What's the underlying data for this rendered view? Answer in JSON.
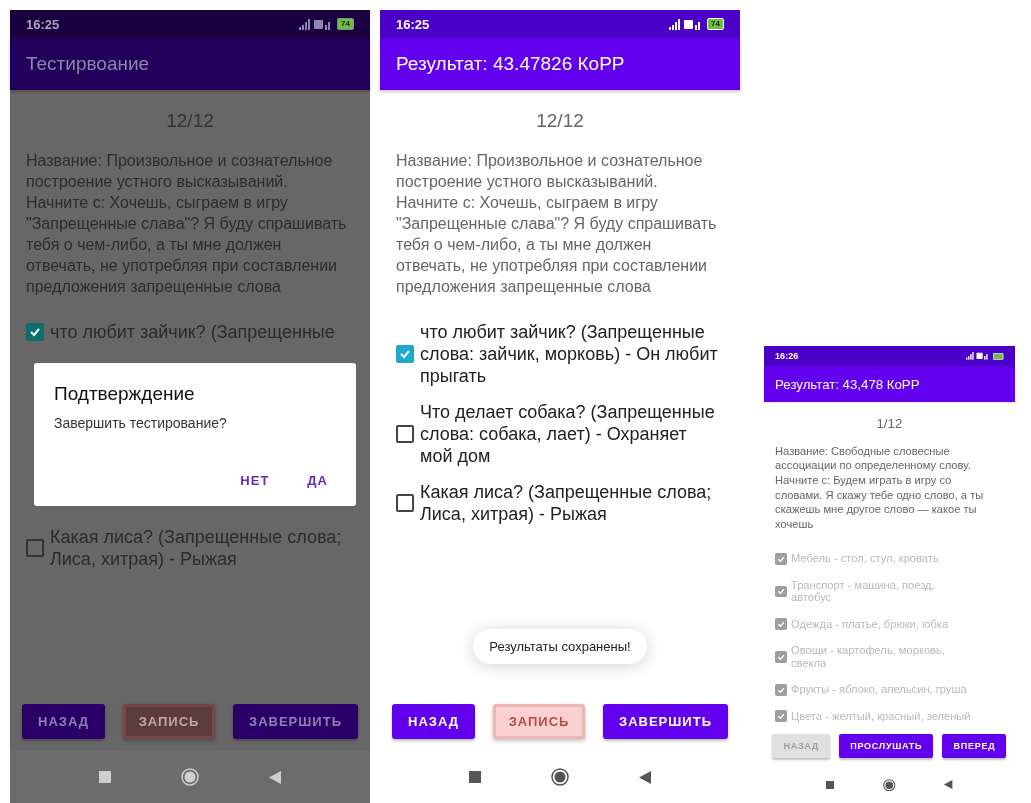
{
  "screens": [
    {
      "dimmed": true,
      "status_bar": {
        "time": "16:25",
        "battery": "74"
      },
      "app_bar": {
        "title": "Тестирвоание"
      },
      "counter": "12/12",
      "description": "Название: Произвольное и сознательное построение устного высказываний. Начните с: Хочешь, сыграем в игру \"Запрещенные слава\"? Я буду спрашивать тебя о чем-либо, а ты мне должен отвечать, не употребляя при составлении предложения запрещенные слова",
      "items": [
        {
          "text": "что любит зайчик? (Запрещенные",
          "checked": true
        },
        {
          "text": "Какая лиса? (Запрещенные слова; Лиса, хитрая) - Рыжая",
          "checked": false
        }
      ],
      "dialog": {
        "title": "Подтверждение",
        "message": "Завершить тестирование?",
        "buttons": [
          "НЕТ",
          "ДА"
        ]
      },
      "buttons": [
        {
          "label": "НАЗАД",
          "kind": "nav",
          "disabled": false
        },
        {
          "label": "ЗАПИСЬ",
          "kind": "record",
          "disabled": true
        },
        {
          "label": "ЗАВЕРШИТЬ",
          "kind": "nav",
          "disabled": false
        }
      ]
    },
    {
      "dimmed": false,
      "status_bar": {
        "time": "16:25",
        "battery": "74"
      },
      "app_bar": {
        "title": "Результат: 43.47826 КоРР"
      },
      "counter": "12/12",
      "description": "Название: Произвольное и сознательное построение устного высказываний. Начните с: Хочешь, сыграем в игру \"Запрещенные слава\"? Я буду спрашивать тебя о чем-либо, а ты мне должен отвечать, не употребляя при составлении предложения запрещенные слова",
      "items": [
        {
          "text": "что любит зайчик? (Запрещенные слова: зайчик, морковь) - Он любит прыгать",
          "checked": true
        },
        {
          "text": "Что делает собака? (Запрещенные слова: собака, лает) - Охраняет мой дом",
          "checked": false
        },
        {
          "text": "Какая лиса? (Запрещенные слова; Лиса, хитрая) - Рыжая",
          "checked": false
        }
      ],
      "toast": "Результаты сохранены!",
      "buttons": [
        {
          "label": "НАЗАД",
          "kind": "nav",
          "disabled": false
        },
        {
          "label": "ЗАПИСЬ",
          "kind": "record",
          "disabled": true
        },
        {
          "label": "ЗАВЕРШИТЬ",
          "kind": "nav",
          "disabled": false
        }
      ]
    },
    {
      "dimmed": false,
      "status_bar": {
        "time": "16:26"
      },
      "app_bar": {
        "title": "Результат: 43,478 КоРР"
      },
      "counter": "1/12",
      "description": "Название: Свободные словесные ассоциации по определенному слову. Начните с: Будем играть в игру со словами. Я скажу тебе одно слово, а ты скажешь мне другое слово — какое ты хочешь",
      "items": [
        {
          "text": "Мебель - стол, стул, кровать",
          "checked": true,
          "disabled": true
        },
        {
          "text": "Транспорт - машина, поезд, автобус",
          "checked": true,
          "disabled": true
        },
        {
          "text": "Одежда - платье, брюки, юбка",
          "checked": true,
          "disabled": true
        },
        {
          "text": "Овощи - картофель, морковь, свекла",
          "checked": true,
          "disabled": true
        },
        {
          "text": "Фрукты - яблоко, апельсин, груша",
          "checked": true,
          "disabled": true
        },
        {
          "text": "Цвета - желтый, красный, зеленый",
          "checked": true,
          "disabled": true
        }
      ],
      "buttons": [
        {
          "label": "НАЗАД",
          "kind": "nav",
          "disabled": true
        },
        {
          "label": "ПРОСЛУШАТЬ",
          "kind": "nav",
          "disabled": false
        },
        {
          "label": "ВПЕРЕД",
          "kind": "nav",
          "disabled": false
        }
      ]
    }
  ]
}
